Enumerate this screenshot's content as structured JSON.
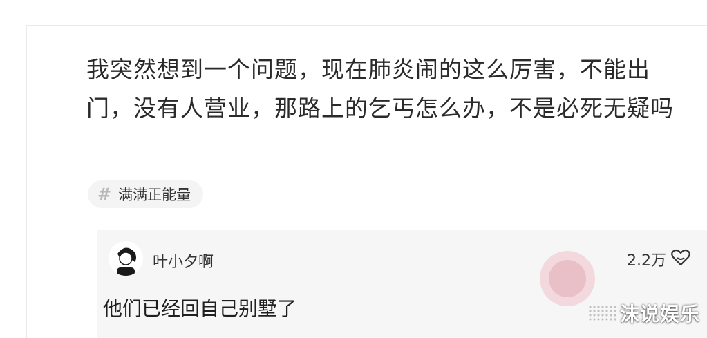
{
  "post": {
    "text": "我突然想到一个问题，现在肺炎闹的这么厉害，不能出门，没有人营业，那路上的乞丐怎么办，不是必死无疑吗"
  },
  "tag": {
    "icon": "hash-icon",
    "label": "满满正能量"
  },
  "comment": {
    "user": "叶小夕啊",
    "likes": "2.2万",
    "like_icon": "like-icon",
    "text": "他们已经回自己别墅了"
  },
  "watermark": {
    "text": "沫说娱乐"
  }
}
